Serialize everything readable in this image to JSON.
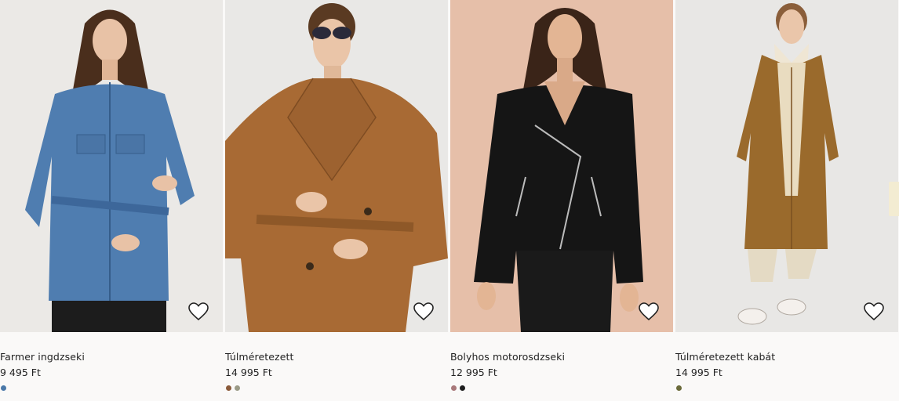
{
  "products": [
    {
      "name": "Farmer ingdzseki",
      "price": "9 495 Ft",
      "bg": "#ebe9e6",
      "colors": [
        "#4a78a8"
      ],
      "swatch_names": [
        "blue"
      ]
    },
    {
      "name": "Túlméretezett",
      "price": "14 995 Ft",
      "bg": "#e9e8e6",
      "colors": [
        "#8a5a3a",
        "#9a9a86"
      ],
      "swatch_names": [
        "brown",
        "khaki"
      ]
    },
    {
      "name": "Bolyhos motorosdzseki",
      "price": "12 995 Ft",
      "bg": "#e6bfa9",
      "colors": [
        "#a8787a",
        "#1e1e1e"
      ],
      "swatch_names": [
        "mauve",
        "black"
      ]
    },
    {
      "name": "Túlméretezett kabát",
      "price": "14 995 Ft",
      "bg": "#e8e7e5",
      "colors": [
        "#6a6a3a"
      ],
      "swatch_names": [
        "olive"
      ]
    }
  ],
  "icons": {
    "favorite": "heart-outline-icon"
  },
  "page_background": "#faf9f8"
}
